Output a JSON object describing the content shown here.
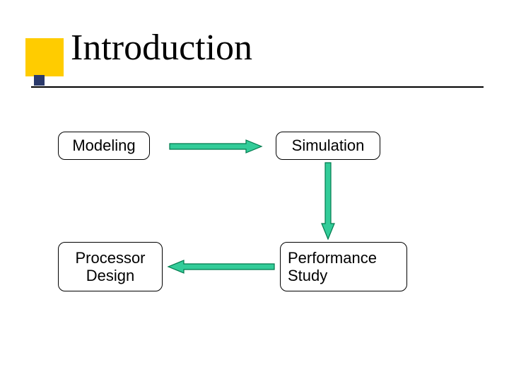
{
  "title": "Introduction",
  "nodes": {
    "modeling": "Modeling",
    "simulation": "Simulation",
    "processor": "Processor\nDesign",
    "performance": "Performance\nStudy"
  },
  "colors": {
    "accent_yellow": "#ffcc00",
    "accent_navy": "#2b3a6b",
    "arrow_fill": "#33cc99",
    "arrow_stroke": "#007a4d"
  },
  "arrows": [
    {
      "from": "modeling",
      "to": "simulation",
      "dir": "right"
    },
    {
      "from": "simulation",
      "to": "performance",
      "dir": "down"
    },
    {
      "from": "performance",
      "to": "processor",
      "dir": "left"
    }
  ]
}
